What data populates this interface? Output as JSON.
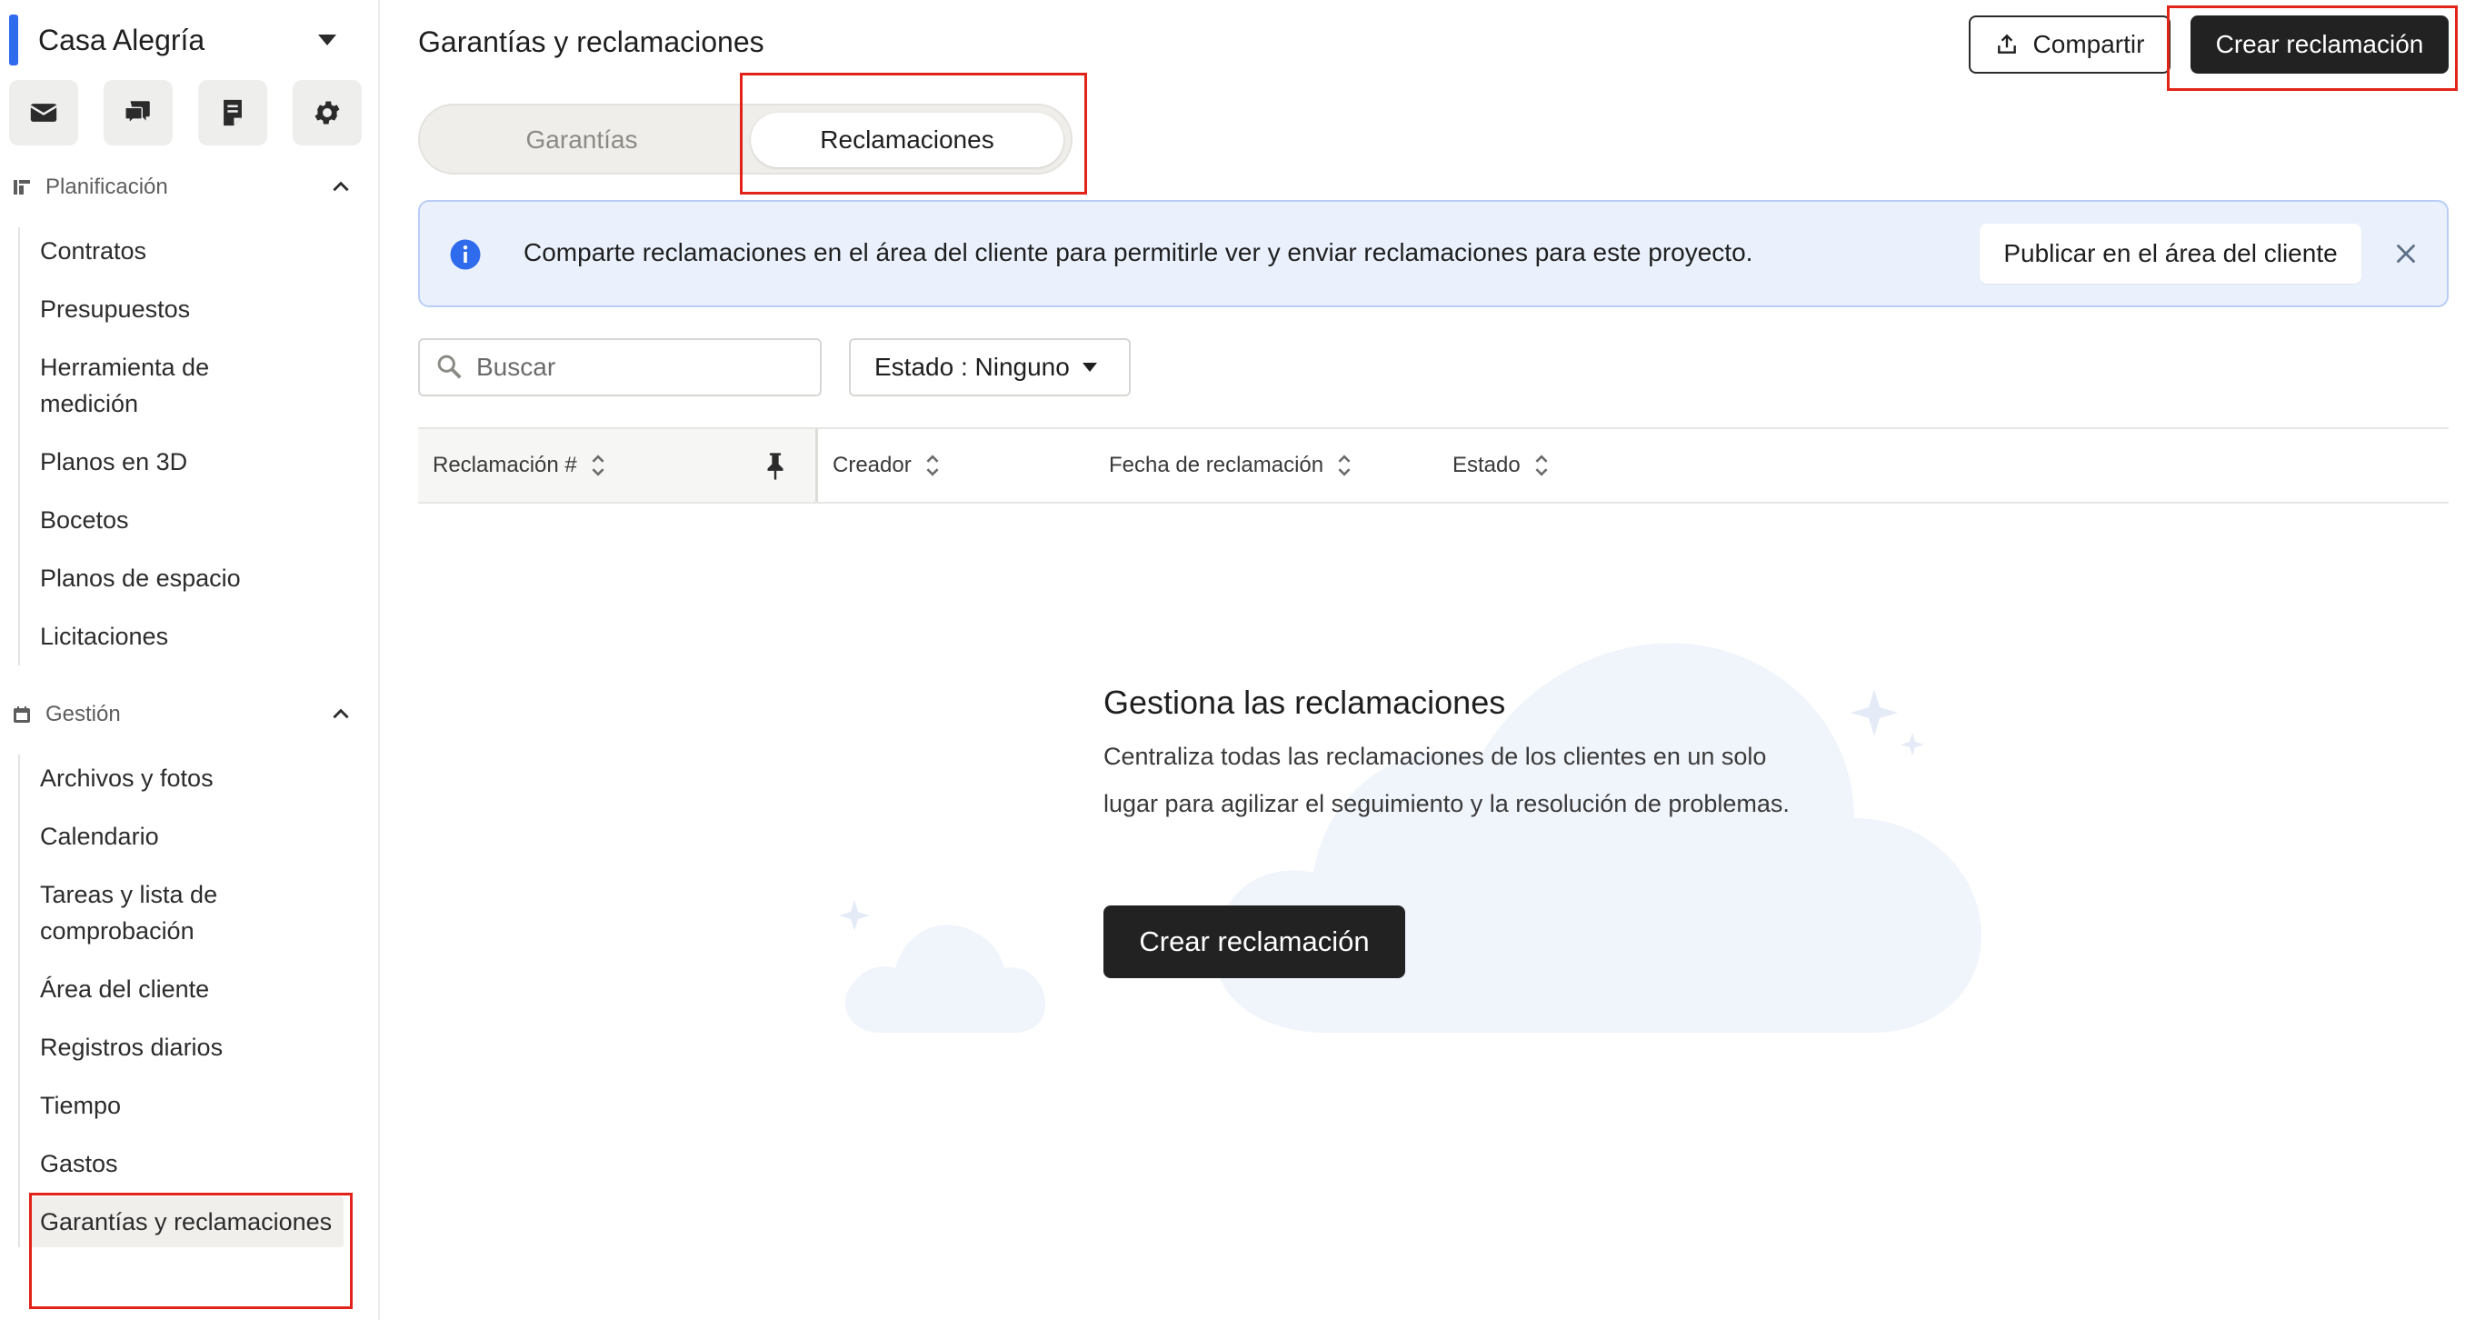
{
  "project": {
    "name": "Casa Alegría"
  },
  "quick_icons": [
    "mail-icon",
    "chat-icon",
    "notes-icon",
    "gear-icon"
  ],
  "sidebar": {
    "planning": {
      "label": "Planificación",
      "items": [
        "Contratos",
        "Presupuestos",
        "Herramienta de medición",
        "Planos en 3D",
        "Bocetos",
        "Planos de espacio",
        "Licitaciones"
      ]
    },
    "management": {
      "label": "Gestión",
      "items": [
        "Archivos y fotos",
        "Calendario",
        "Tareas y lista de comprobación",
        "Área del cliente",
        "Registros diarios",
        "Tiempo",
        "Gastos",
        "Garantías y reclamaciones"
      ]
    }
  },
  "header": {
    "title": "Garantías y reclamaciones",
    "share_label": "Compartir",
    "create_label": "Crear reclamación"
  },
  "tabs": {
    "warranties": "Garantías",
    "claims": "Reclamaciones",
    "active": "claims"
  },
  "banner": {
    "text": "Comparte reclamaciones en el área del cliente para permitirle ver y enviar reclamaciones para este proyecto.",
    "publish_label": "Publicar en el área del cliente"
  },
  "search": {
    "placeholder": "Buscar",
    "value": ""
  },
  "filter": {
    "label": "Estado : Ninguno"
  },
  "table": {
    "columns": [
      "Reclamación #",
      "Creador",
      "Fecha de reclamación",
      "Estado"
    ]
  },
  "empty_state": {
    "title": "Gestiona las reclamaciones",
    "description": "Centraliza todas las reclamaciones de los clientes en un solo lugar para agilizar el seguimiento y la resolución de problemas.",
    "button_label": "Crear reclamación"
  },
  "colors": {
    "accent": "#2f6bed",
    "primary_button": "#222222",
    "highlight": "#e2231a",
    "banner_bg": "#eaf1fd"
  }
}
